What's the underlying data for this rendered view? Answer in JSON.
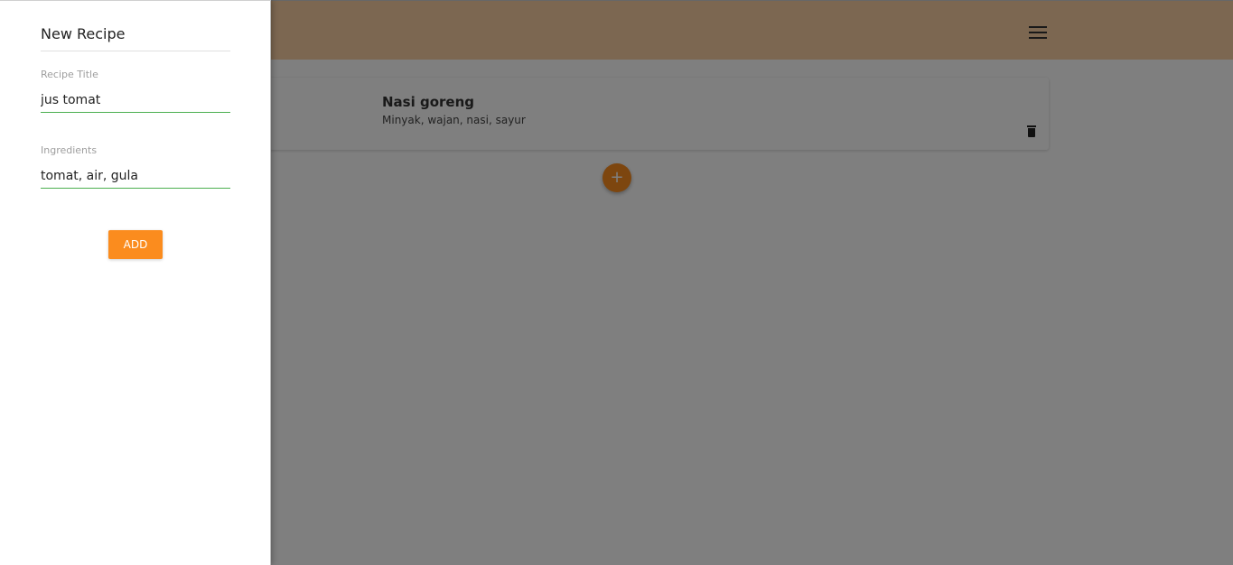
{
  "header": {
    "menu_icon": "hamburger-menu-icon",
    "background_color": "#f8cfa2"
  },
  "recipes": [
    {
      "title": "Nasi goreng",
      "ingredients": "Minyak, wajan, nasi, sayur",
      "delete_icon": "trash-icon"
    }
  ],
  "fab": {
    "label": "+",
    "color": "#fb8c1e"
  },
  "drawer": {
    "title": "New Recipe",
    "fields": [
      {
        "label": "Recipe Title",
        "value": "jus tomat"
      },
      {
        "label": "Ingredients",
        "value": "tomat, air, gula"
      }
    ],
    "add_button_label": "ADD",
    "accent_color": "#fb8c1e",
    "input_underline_color": "#4caf50"
  }
}
